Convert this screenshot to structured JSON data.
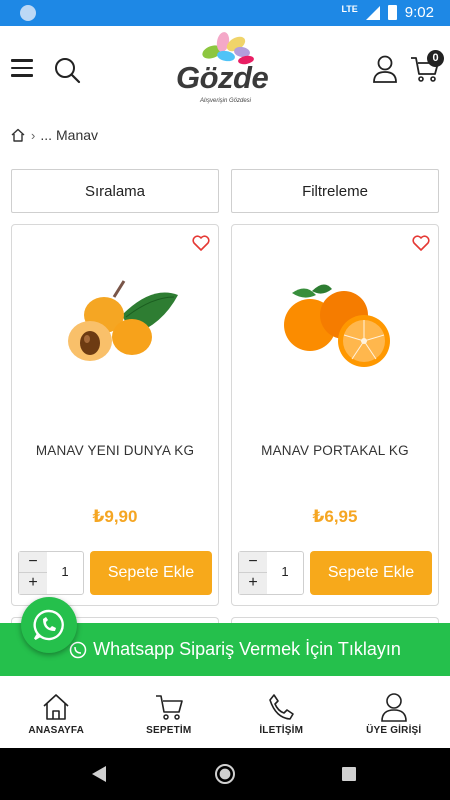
{
  "status_bar": {
    "network": "LTE",
    "time": "9:02"
  },
  "header": {
    "logo_text": "Gözde",
    "logo_tagline": "Alışverişin Gözdesi",
    "cart_count": "0"
  },
  "breadcrumb": {
    "ellipsis": "...",
    "current": "Manav"
  },
  "toolbar": {
    "sort_label": "Sıralama",
    "filter_label": "Filtreleme"
  },
  "products": [
    {
      "name": "MANAV YENI DUNYA KG",
      "price": "₺9,90",
      "quantity": "1",
      "add_label": "Sepete Ekle"
    },
    {
      "name": "MANAV PORTAKAL KG",
      "price": "₺6,95",
      "quantity": "1",
      "add_label": "Sepete Ekle"
    }
  ],
  "whatsapp": {
    "label": "Whatsapp Sipariş Vermek İçin Tıklayın"
  },
  "bottom_nav": [
    {
      "label": "ANASAYFA",
      "icon": "home-icon"
    },
    {
      "label": "SEPETİM",
      "icon": "cart-icon"
    },
    {
      "label": "İLETİŞİM",
      "icon": "phone-icon"
    },
    {
      "label": "ÜYE GİRİŞİ",
      "icon": "user-icon"
    }
  ],
  "colors": {
    "accent": "#f7a91b",
    "price": "#f5a623",
    "whatsapp": "#25c04c",
    "status_bar": "#1e88e5"
  }
}
